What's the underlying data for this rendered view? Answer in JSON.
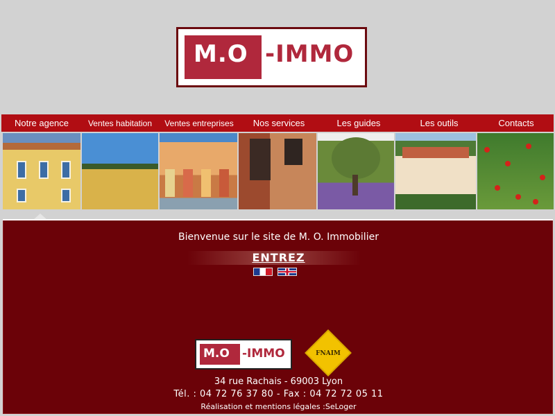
{
  "brand": {
    "logo_left": "M.O",
    "logo_right": "-IMMO",
    "accent": "#b0283c",
    "dark": "#6b0208"
  },
  "nav": {
    "items": [
      {
        "label": "Notre agence"
      },
      {
        "label": "Ventes habitation"
      },
      {
        "label": "Ventes entreprises"
      },
      {
        "label": "Nos services"
      },
      {
        "label": "Les guides"
      },
      {
        "label": "Les outils"
      },
      {
        "label": "Contacts"
      }
    ]
  },
  "main": {
    "welcome": "Bienvenue sur le site de M. O. Immobilier",
    "enter_label": "ENTREZ"
  },
  "footer": {
    "logo_left": "M.O",
    "logo_right": "-IMMO",
    "fnaim": "FNAIM",
    "address": "34 rue Rachais - 69003 Lyon",
    "phone": "Tél. : 04 72 76 37 80 - Fax : 04 72 72 05 11",
    "legal_prefix": "Réalisation et mentions légales :",
    "legal_link": "SeLoger"
  }
}
